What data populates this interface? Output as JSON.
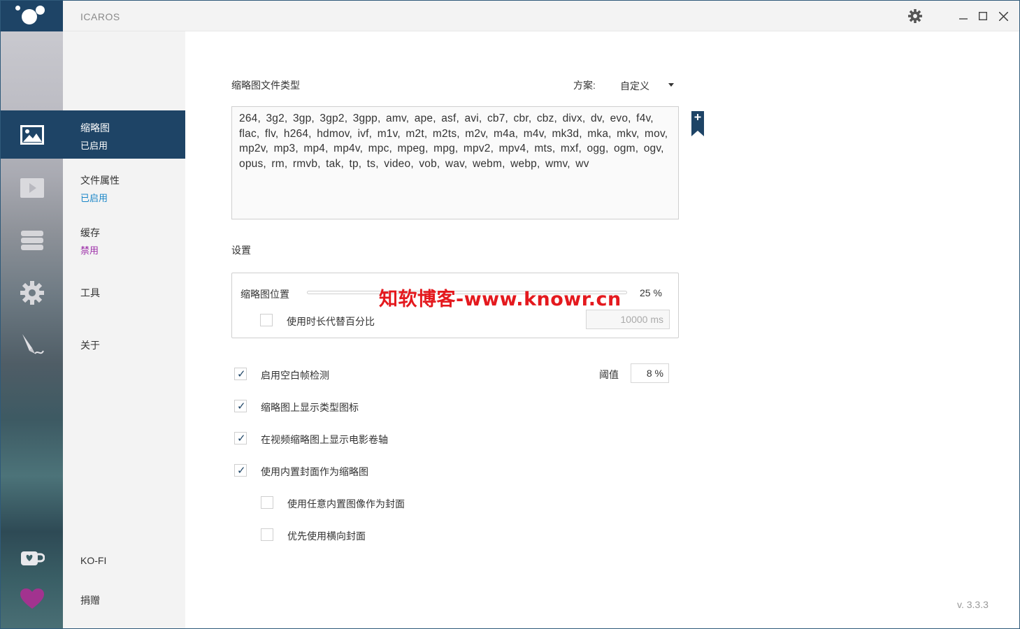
{
  "app": {
    "title": "ICAROS",
    "version": "v. 3.3.3"
  },
  "titlebar": {
    "settings_icon": "gear-icon",
    "minimize": "─",
    "maximize": "☐",
    "close": "✕"
  },
  "nav": [
    {
      "label": "缩略图",
      "status": "已启用",
      "icon": "image-icon",
      "active": true
    },
    {
      "label": "文件属性",
      "status": "已启用",
      "icon": "play-icon",
      "active": false
    },
    {
      "label": "缓存",
      "status": "禁用",
      "icon": "database-icon",
      "active": false
    },
    {
      "label": "工具",
      "status": "",
      "icon": "gear-icon",
      "active": false
    },
    {
      "label": "关于",
      "status": "",
      "icon": "quill-icon",
      "active": false
    }
  ],
  "nav_bottom": {
    "kofi": "KO-FI",
    "donate": "捐赠"
  },
  "thumbnail_types": {
    "heading": "缩略图文件类型",
    "scheme_label": "方案:",
    "scheme_value": "自定义",
    "extensions": "264, 3g2, 3gp, 3gp2, 3gpp, amv, ape, asf, avi, cb7, cbr, cbz, divx, dv, evo, f4v, flac, flv, h264, hdmov, ivf, m1v, m2t, m2ts, m2v, m4a, m4v, mk3d, mka, mkv, mov, mp2v, mp3, mp4, mp4v, mpc, mpeg, mpg, mpv2, mpv4, mts, mxf, ogg, ogm, ogv, opus, rm, rmvb, tak, tp, ts, video, vob, wav, webm, webp, wmv, wv"
  },
  "settings": {
    "heading": "设置",
    "position_label": "缩略图位置",
    "position_value": "25 %",
    "position_fraction": 0.25,
    "use_duration_label": "使用时长代替百分比",
    "use_duration_checked": false,
    "duration_value": "10000 ms",
    "watermark": "知软博客-www.knowr.cn"
  },
  "options": [
    {
      "label": "启用空白帧检测",
      "checked": true,
      "indent": false
    },
    {
      "label": "缩略图上显示类型图标",
      "checked": true,
      "indent": false
    },
    {
      "label": "在视频缩略图上显示电影卷轴",
      "checked": true,
      "indent": false
    },
    {
      "label": "使用内置封面作为缩略图",
      "checked": true,
      "indent": false
    },
    {
      "label": "使用任意内置图像作为封面",
      "checked": false,
      "indent": true
    },
    {
      "label": "优先使用横向封面",
      "checked": false,
      "indent": true
    }
  ],
  "threshold": {
    "label": "阈值",
    "value": "8 %"
  },
  "colors": {
    "accent": "#1e4466",
    "enabled_text": "#1a86c8",
    "disabled_text": "#9c2da8",
    "donate_text": "#a2338f",
    "heart": "#a2338f"
  }
}
